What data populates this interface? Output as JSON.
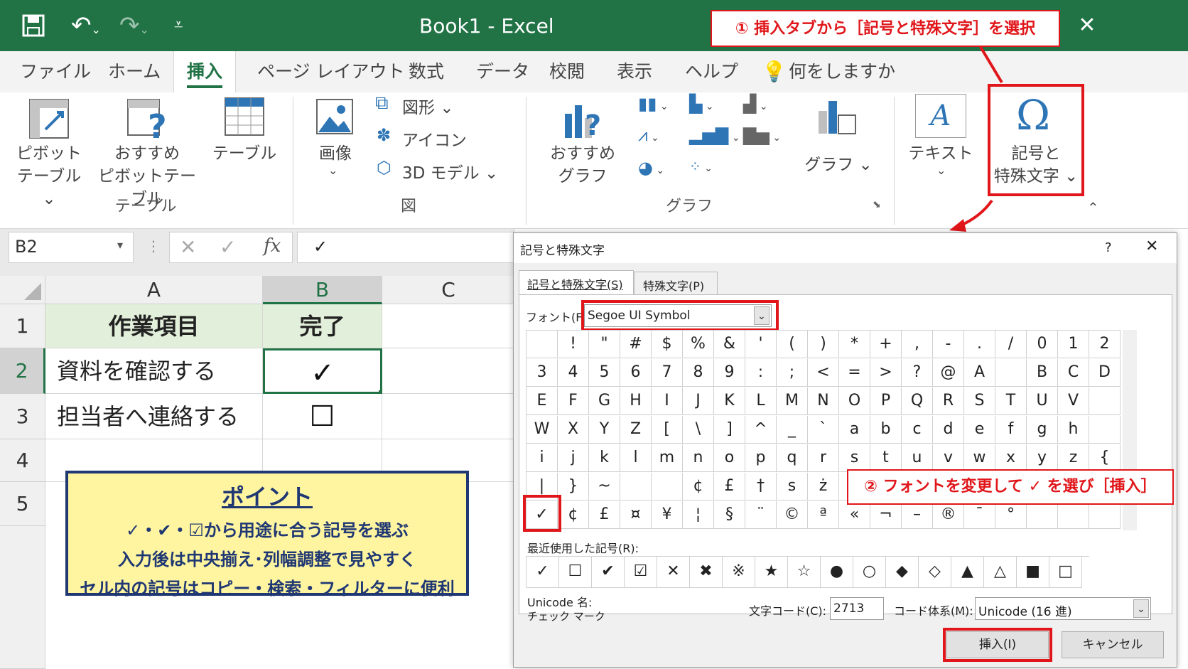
{
  "titlebar": {
    "title": "Book1  -  Excel",
    "callout1": "① 挿入タブから［記号と特殊文字］を選択",
    "close": "✕"
  },
  "tabs": [
    "ファイル",
    "ホーム",
    "挿入",
    "ページ レイアウト",
    "数式",
    "データ",
    "校閲",
    "表示",
    "ヘルプ",
    "何をしますか"
  ],
  "ribbon": {
    "pivot": [
      "ピボット",
      "テーブル ⌄"
    ],
    "recommended_pivot": [
      "おすすめ",
      "ピボットテーブル"
    ],
    "table": "テーブル",
    "group_table": "テーブル",
    "image": "画像",
    "shapes": "図形 ⌄",
    "icons": "アイコン",
    "model3d": "3D モデル  ⌄",
    "group_figure": "図",
    "recommended_chart": [
      "おすすめ",
      "グラフ"
    ],
    "chart": "グラフ ⌄",
    "group_chart": "グラフ",
    "text": "テキスト",
    "symbols": [
      "記号と",
      "特殊文字 ⌄"
    ]
  },
  "formula": {
    "namebox": "B2",
    "value": "✓",
    "fx": "fx"
  },
  "sheet": {
    "cols": [
      "A",
      "B",
      "C"
    ],
    "rows": [
      "1",
      "2",
      "3",
      "4",
      "5"
    ],
    "header_a": "作業項目",
    "header_b": "完了",
    "row2_a": "資料を確認する",
    "row2_b": "✓",
    "row3_a": "担当者へ連絡する",
    "row3_b": "☐"
  },
  "point": {
    "title": "ポイント",
    "lines": [
      "✓・✔・☑から用途に合う記号を選ぶ",
      "入力後は中央揃え･列幅調整で見やすく",
      "セル内の記号はコピー・検索・フィルターに便利"
    ]
  },
  "dialog": {
    "title": "記号と特殊文字",
    "help": "?",
    "close": "✕",
    "tab1": "記号と特殊文字(S)",
    "tab2": "特殊文字(P)",
    "font_label": "フォント(F):",
    "font_value": "Segoe UI Symbol",
    "grid": [
      [
        "",
        "!",
        "\"",
        "#",
        "$",
        "%",
        "&",
        "'",
        "(",
        ")",
        "*",
        "+",
        ",",
        "-",
        ".",
        "/",
        "0",
        "1",
        "2"
      ],
      [
        "3",
        "4",
        "5",
        "6",
        "7",
        "8",
        "9",
        ":",
        ";",
        "<",
        "=",
        ">",
        "?",
        "@",
        "A",
        "",
        "B",
        "C",
        "D"
      ],
      [
        "E",
        "F",
        "G",
        "H",
        "I",
        "J",
        "K",
        "L",
        "M",
        "N",
        "O",
        "P",
        "Q",
        "R",
        "S",
        "T",
        "U",
        "V",
        ""
      ],
      [
        "W",
        "X",
        "Y",
        "Z",
        "[",
        "\\",
        "]",
        "^",
        "_",
        "`",
        "a",
        "b",
        "c",
        "d",
        "e",
        "f",
        "g",
        "h",
        ""
      ],
      [
        "i",
        "j",
        "k",
        "l",
        "m",
        "n",
        "o",
        "p",
        "q",
        "r",
        "s",
        "t",
        "u",
        "v",
        "w",
        "x",
        "y",
        "z",
        "{"
      ],
      [
        "|",
        "}",
        "~",
        "",
        "",
        "¢",
        "£",
        "†",
        "s",
        "ż",
        "",
        "",
        "",
        "",
        "",
        "",
        "",
        "",
        ""
      ],
      [
        "✓",
        "¢",
        "£",
        "¤",
        "¥",
        "¦",
        "§",
        "¨",
        "©",
        "ª",
        "«",
        "¬",
        "–",
        "®",
        "¯",
        "°",
        "",
        "",
        ""
      ]
    ],
    "callout2": "② フォントを変更して ✓ を選び［挿入］",
    "recent_label": "最近使用した記号(R):",
    "recent": [
      "✓",
      "☐",
      "✔",
      "☑",
      "✕",
      "✖",
      "※",
      "★",
      "☆",
      "●",
      "○",
      "◆",
      "◇",
      "▲",
      "△",
      "■",
      "□"
    ],
    "unicode_label": "Unicode 名:",
    "unicode_name": "チェック マーク",
    "code_label": "文字コード(C):",
    "code_value": "2713",
    "system_label": "コード体系(M):",
    "system_value": "Unicode (16 進)",
    "insert": "挿入(I)",
    "cancel": "キャンセル"
  }
}
